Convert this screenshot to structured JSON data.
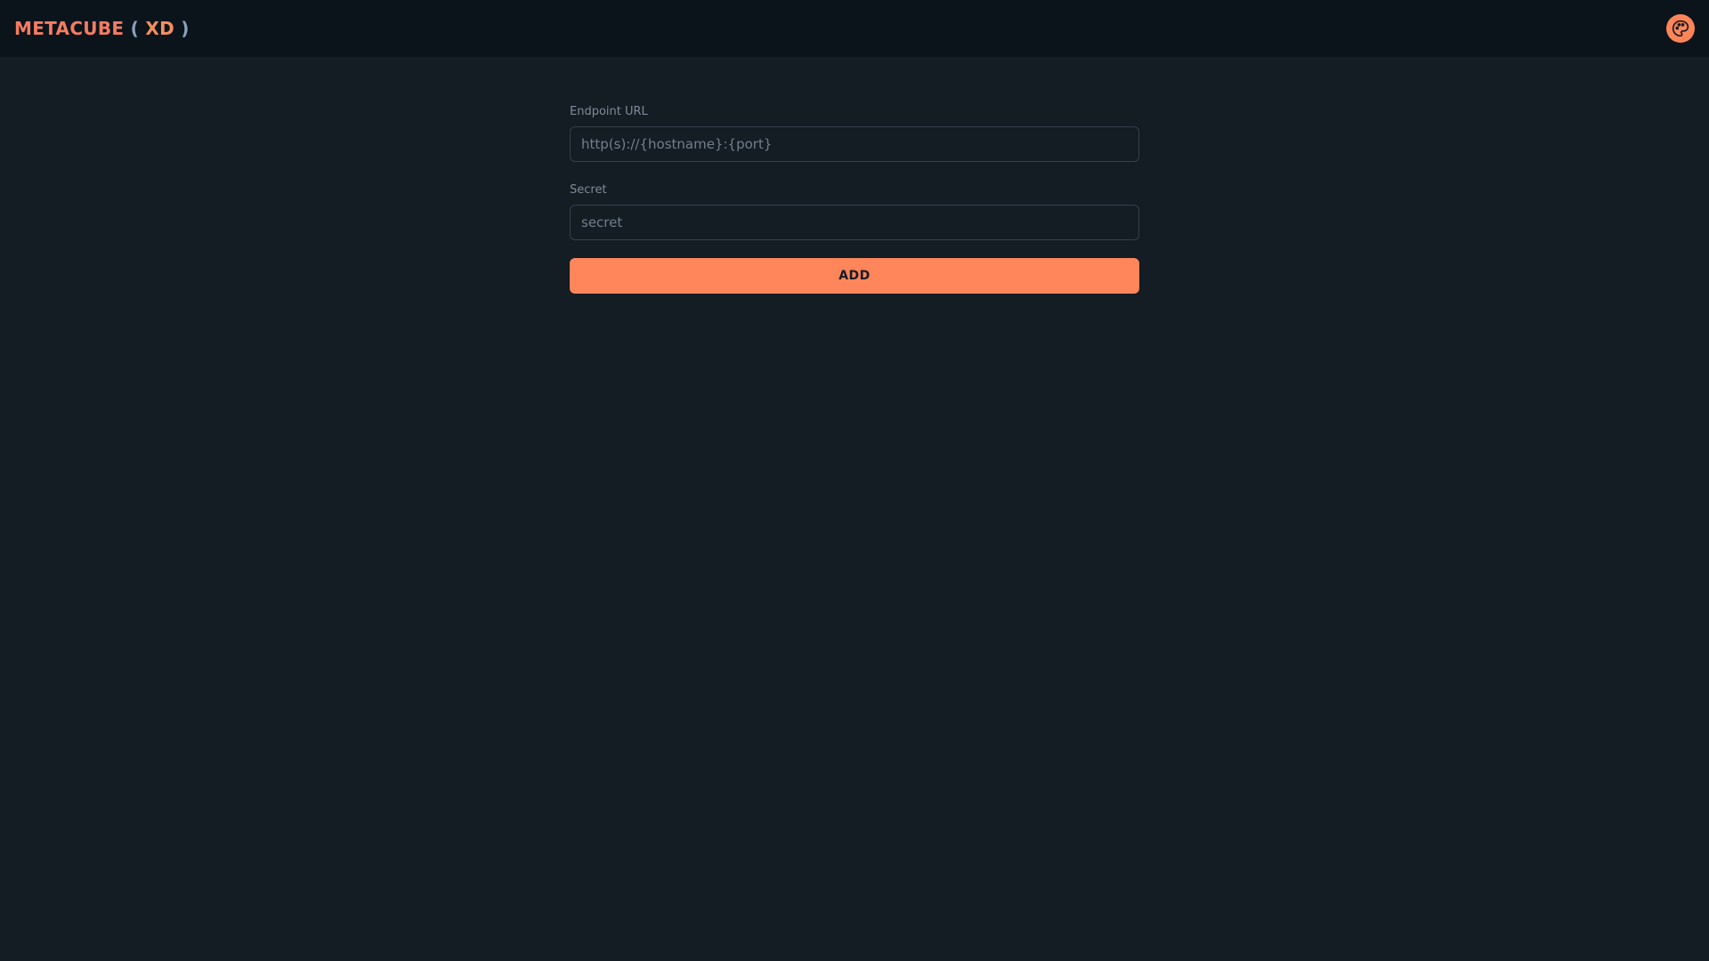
{
  "header": {
    "brand_name": "METACUBE",
    "brand_open": "(",
    "brand_tag": "XD",
    "brand_close": ")",
    "theme_icon": "palette-icon"
  },
  "form": {
    "endpoint_label": "Endpoint URL",
    "endpoint_placeholder": "http(s)://{hostname}:{port}",
    "endpoint_value": "",
    "secret_label": "Secret",
    "secret_placeholder": "secret",
    "secret_value": "",
    "add_label": "ADD"
  },
  "colors": {
    "background": "#141c24",
    "header_background": "#0b131b",
    "accent": "#ff855a",
    "brand": "#f37c62"
  }
}
